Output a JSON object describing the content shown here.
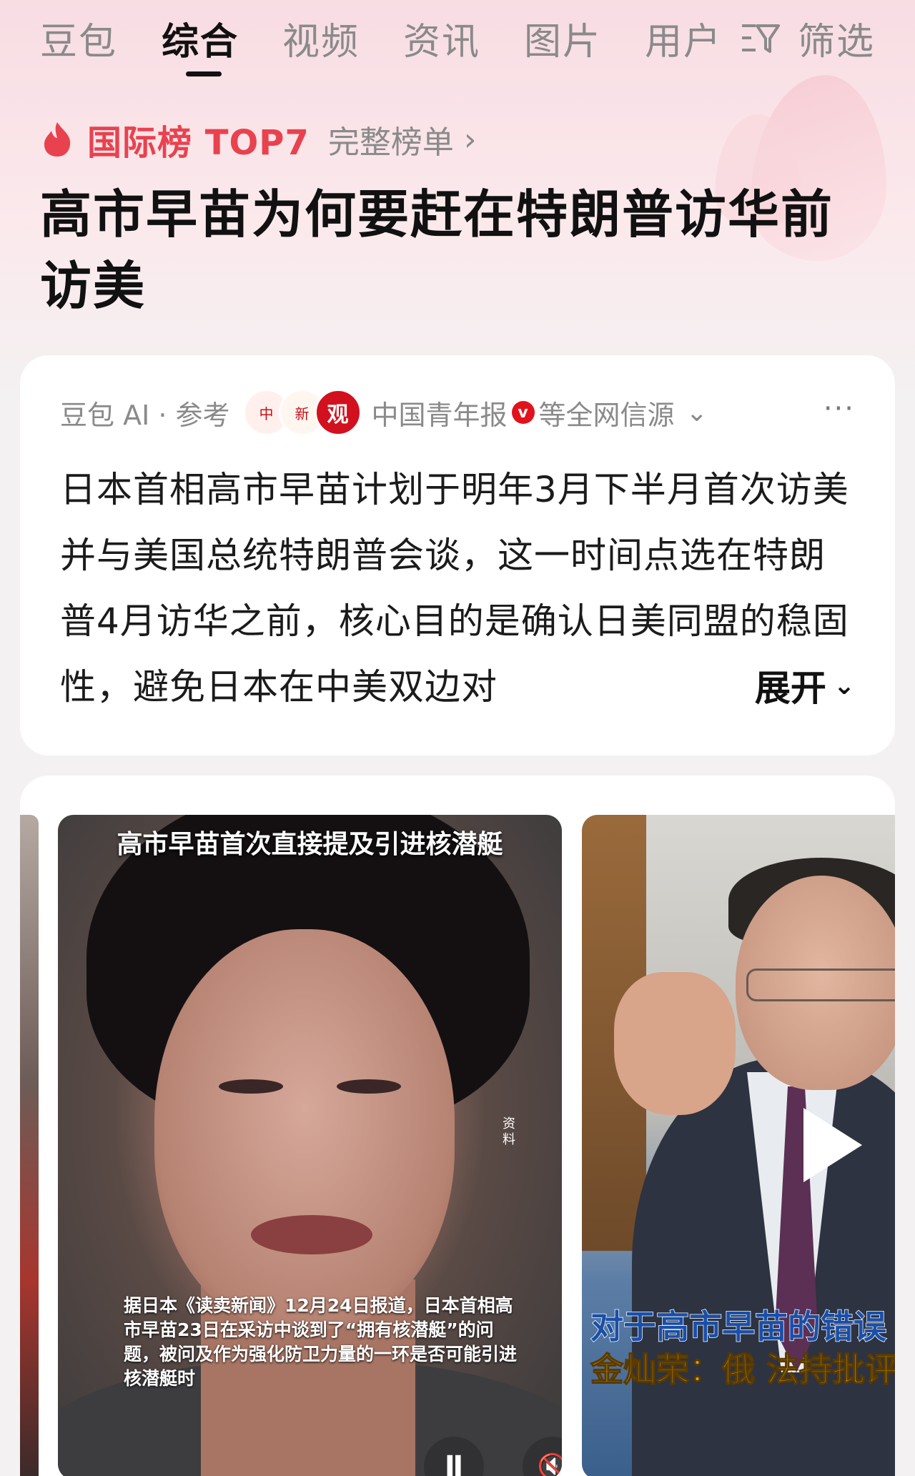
{
  "tabs": [
    {
      "label": "豆包"
    },
    {
      "label": "综合",
      "active": true
    },
    {
      "label": "视频"
    },
    {
      "label": "资讯"
    },
    {
      "label": "图片"
    },
    {
      "label": "用户"
    }
  ],
  "filter": {
    "label": "筛选",
    "icon": "filter-icon"
  },
  "rank": {
    "icon": "fire-icon",
    "title": "国际榜 TOP7",
    "link": "完整榜单",
    "chevron": "›"
  },
  "headline": "高市早苗为何要赶在特朗普访华前访美",
  "ai_card": {
    "source_prefix": "豆包 AI · 参考",
    "source_name": "中国青年报",
    "verified_badge": "v",
    "source_suffix": "等全网信源",
    "logo_3_text": "观",
    "more": "···",
    "summary": "日本首相高市早苗计划于明年3月下半月首次访美并与美国总统特朗普会谈，这一时间点选在特朗普4月访华之前，核心目的是确认日美同盟的稳固性，避免日本在中美双边对",
    "expand_label": "展开",
    "expand_icon": "chevron-down-icon"
  },
  "videos": [
    {
      "top_title": "高市早苗首次直接提及引进核潜艇",
      "side_note": "资料",
      "caption": "据日本《读卖新闻》12月24日报道，日本首相高市早苗23日在采访中谈到了“拥有核潜艇”的问题，被问及作为强化防卫力量的一环是否可能引进核潜艇时",
      "pause_icon": "Ⅱ",
      "mute_icon": "🔇"
    },
    {
      "caption_line1": "对于高市早苗的错误",
      "caption_line2": "金灿荣：俄 法持批评"
    }
  ],
  "colors": {
    "accent_red": "#e8424f",
    "verified_red": "#e1121c",
    "background": "#f3f1f2"
  }
}
